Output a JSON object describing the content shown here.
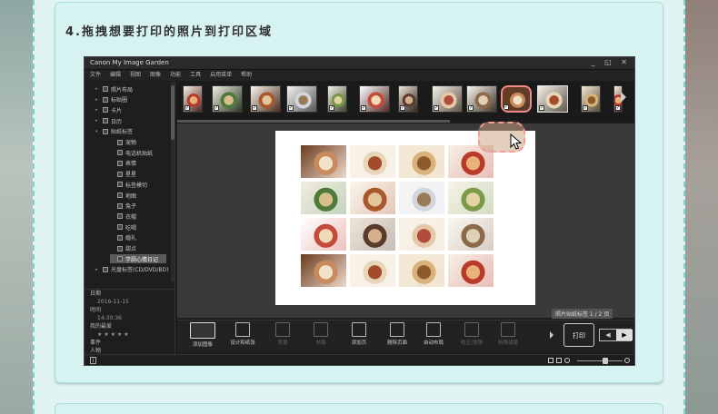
{
  "article": {
    "step_title": "4.拖拽想要打印的照片到打印区域"
  },
  "app": {
    "title": "Canon My Image Garden",
    "window_controls": "_ ◱ ✕",
    "menu": [
      "文件",
      "编辑",
      "视图",
      "图像",
      "功能",
      "工具",
      "启用菜单",
      "帮助"
    ],
    "tree": [
      {
        "label": "照片布局",
        "level": 1,
        "arrow": "▸"
      },
      {
        "label": "标贴圈",
        "level": 1,
        "arrow": "▸"
      },
      {
        "label": "卡片",
        "level": 1,
        "arrow": "▸"
      },
      {
        "label": "日历",
        "level": 1,
        "arrow": "▸"
      },
      {
        "label": "贴纸标签",
        "level": 1,
        "arrow": "▾"
      },
      {
        "label": "宠物",
        "level": 2,
        "arrow": ""
      },
      {
        "label": "电话机贴纸",
        "level": 2,
        "arrow": ""
      },
      {
        "label": "表情",
        "level": 2,
        "arrow": ""
      },
      {
        "label": "星星",
        "level": 2,
        "arrow": ""
      },
      {
        "label": "标签模切",
        "level": 2,
        "arrow": ""
      },
      {
        "label": "地图",
        "level": 2,
        "arrow": ""
      },
      {
        "label": "兔子",
        "level": 2,
        "arrow": ""
      },
      {
        "label": "衣帽",
        "level": 2,
        "arrow": ""
      },
      {
        "label": "吃喝",
        "level": 2,
        "arrow": ""
      },
      {
        "label": "婚礼",
        "level": 2,
        "arrow": ""
      },
      {
        "label": "甜点",
        "level": 2,
        "arrow": ""
      },
      {
        "label": "学厨心情日记",
        "level": 2,
        "arrow": "",
        "selected": true
      },
      {
        "label": "光盘标签(CD/DVD/BD)",
        "level": 1,
        "arrow": "▸"
      }
    ],
    "info": {
      "date_label": "日期",
      "date_value": "2016-11-15",
      "time_label": "时间",
      "time_value": "14:30:36",
      "rating_label": "我的最爱",
      "rating_value": "★ ★ ★ ★ ★",
      "event_label": "事件",
      "person_label": "人物"
    },
    "page_caption": "照片贴纸标签 1 / 2 页",
    "toolbar": [
      {
        "label": "添加图像",
        "state": "active"
      },
      {
        "label": "设计和纸张",
        "state": "normal"
      },
      {
        "label": "背景",
        "state": "dim"
      },
      {
        "label": "布局",
        "state": "dim"
      },
      {
        "label": "添加页",
        "state": "normal"
      },
      {
        "label": "删除页面",
        "state": "normal"
      },
      {
        "label": "自动布局",
        "state": "normal"
      },
      {
        "label": "校正/增强",
        "state": "dim"
      },
      {
        "label": "特殊滤镜",
        "state": "dim"
      }
    ],
    "print_label": "打印",
    "nav": {
      "prev": "◀",
      "next": "▶"
    },
    "status_info": "i",
    "colors": {
      "app_bg": "#1c1c1c",
      "workarea_bg": "#3a3a3a",
      "drag_outline": "#f39a9a",
      "card_bg": "#d6f2f1",
      "frame_dash": "#7fd3cf"
    }
  }
}
